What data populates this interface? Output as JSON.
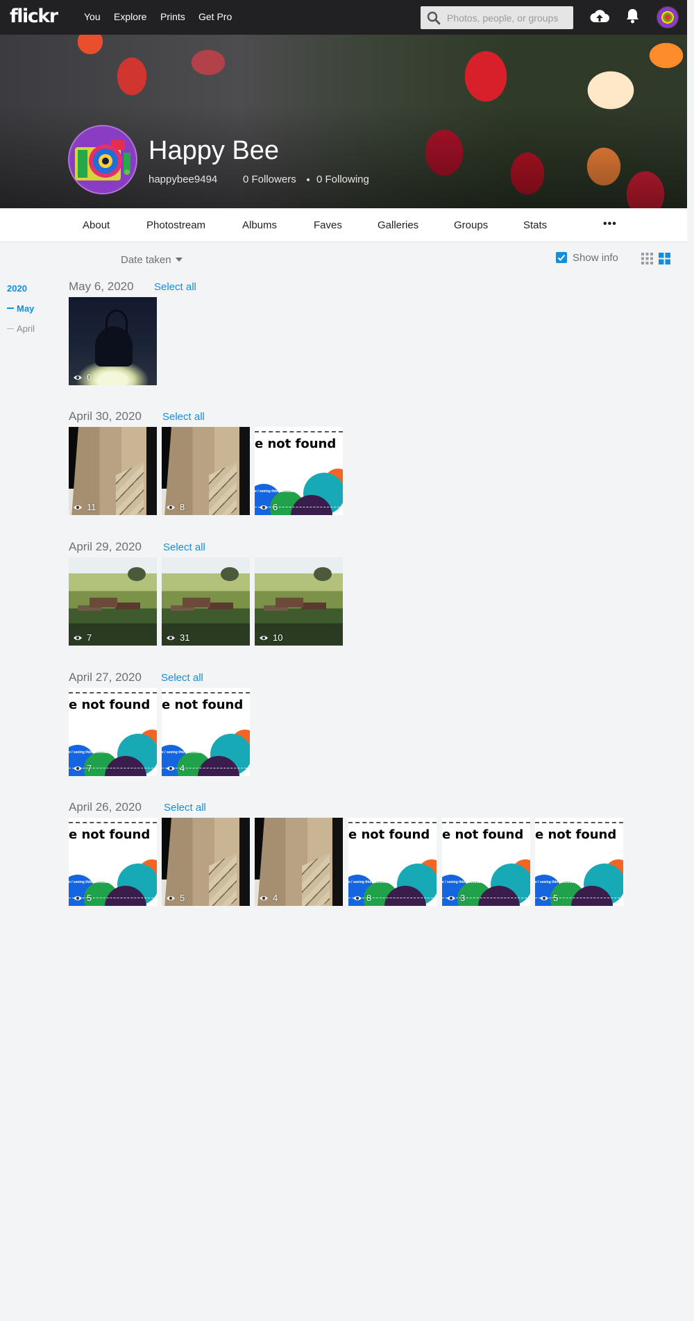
{
  "topnav": {
    "logo": "flickr",
    "links": [
      "You",
      "Explore",
      "Prints",
      "Get Pro"
    ],
    "search_placeholder": "Photos, people, or groups",
    "icons": [
      "search-icon",
      "upload-icon",
      "bell-icon",
      "avatar"
    ]
  },
  "profile": {
    "name": "Happy Bee",
    "username": "happybee9494",
    "followers": "0 Followers",
    "following": "0 Following"
  },
  "subnav": {
    "items": [
      "About",
      "Photostream",
      "Albums",
      "Faves",
      "Galleries",
      "Groups",
      "Stats"
    ],
    "more": "•••"
  },
  "toolbar": {
    "sort_label": "Date taken",
    "show_info_label": "Show info",
    "show_info_checked": true
  },
  "timeline": {
    "year": "2020",
    "months": [
      "May",
      "April"
    ],
    "active_month": "May"
  },
  "groups": [
    {
      "date": "May 6, 2020",
      "select_all": "Select all",
      "photos": [
        {
          "kind": "lamp",
          "views": "0"
        }
      ]
    },
    {
      "date": "April 30, 2020",
      "select_all": "Select all",
      "photos": [
        {
          "kind": "wood",
          "views": "11"
        },
        {
          "kind": "wood",
          "views": "8"
        },
        {
          "kind": "notfound",
          "views": "6"
        }
      ]
    },
    {
      "date": "April 29, 2020",
      "select_all": "Select all",
      "photos": [
        {
          "kind": "farm",
          "views": "7"
        },
        {
          "kind": "farm",
          "views": "31"
        },
        {
          "kind": "farm",
          "views": "10"
        }
      ]
    },
    {
      "date": "April 27, 2020",
      "select_all": "Select all",
      "photos": [
        {
          "kind": "notfound",
          "views": "7"
        },
        {
          "kind": "notfound",
          "views": "4"
        }
      ]
    },
    {
      "date": "April 26, 2020",
      "select_all": "Select all",
      "photos": [
        {
          "kind": "notfound",
          "views": "5"
        },
        {
          "kind": "wood",
          "views": "5"
        },
        {
          "kind": "wood",
          "views": "4"
        },
        {
          "kind": "notfound",
          "views": "8"
        },
        {
          "kind": "notfound",
          "views": "3"
        },
        {
          "kind": "notfound",
          "views": "5"
        }
      ]
    }
  ],
  "placeholder_image": {
    "headline": "e not found",
    "small_text": "e / seeing this? ifi.nt/bd"
  },
  "colors": {
    "accent": "#128fdc",
    "topbar": "#212124",
    "page_bg": "#f3f4f6"
  }
}
